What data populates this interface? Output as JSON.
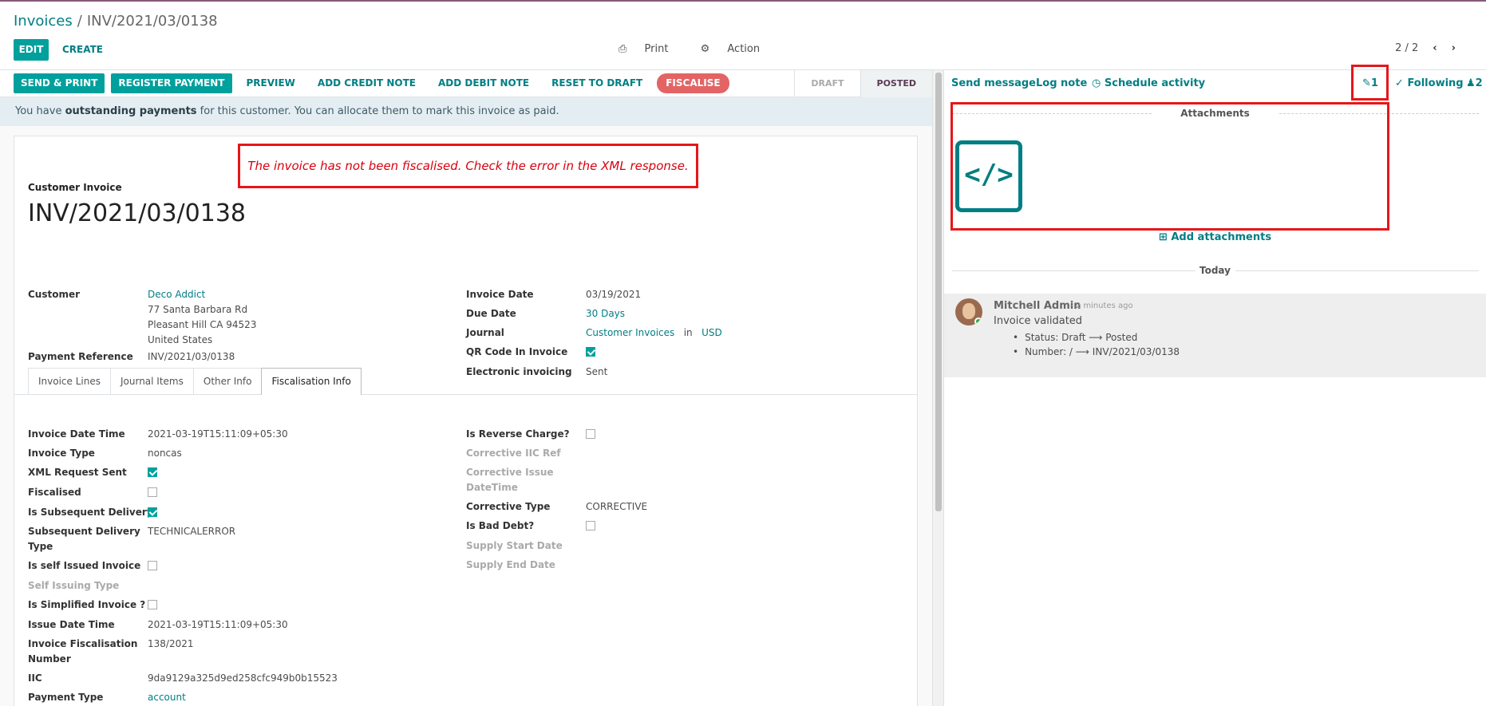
{
  "breadcrumb": {
    "parent": "Invoices",
    "separator": "/",
    "current": "INV/2021/03/0138"
  },
  "control_panel": {
    "edit_label": "EDIT",
    "create_label": "CREATE",
    "print_label": "Print",
    "action_label": "Action",
    "pager_value": "2 / 2",
    "prev_glyph": "‹",
    "next_glyph": "›"
  },
  "statusbar": {
    "buttons": [
      "SEND & PRINT",
      "REGISTER PAYMENT",
      "PREVIEW",
      "ADD CREDIT NOTE",
      "ADD DEBIT NOTE",
      "RESET TO DRAFT",
      "FISCALISE"
    ],
    "states": [
      "DRAFT",
      "POSTED"
    ],
    "active_state": "POSTED"
  },
  "alert": {
    "prefix": "You have",
    "bold": "outstanding payments",
    "suffix": "for this customer. You can allocate them to mark this invoice as paid."
  },
  "error_message": "The invoice has not been fiscalised. Check the error in the XML response.",
  "invoice": {
    "type_label": "Customer Invoice",
    "number": "INV/2021/03/0138",
    "customer_label": "Customer",
    "customer_name": "Deco Addict",
    "address_lines": [
      "77 Santa Barbara Rd",
      "Pleasant Hill CA 94523",
      "United States"
    ],
    "payment_ref_label": "Payment Reference",
    "payment_ref": "INV/2021/03/0138",
    "invoice_date_label": "Invoice Date",
    "invoice_date": "03/19/2021",
    "due_date_label": "Due Date",
    "due_date": "30 Days",
    "journal_label": "Journal",
    "journal": "Customer Invoices",
    "journal_in": "in",
    "currency": "USD",
    "qr_label": "QR Code In Invoice",
    "qr_checked": true,
    "einv_label": "Electronic invoicing",
    "einv_value": "Sent"
  },
  "tabs": [
    "Invoice Lines",
    "Journal Items",
    "Other Info",
    "Fiscalisation Info"
  ],
  "active_tab": "Fiscalisation Info",
  "fiscal": {
    "invoice_datetime_label": "Invoice Date Time",
    "invoice_datetime": "2021-03-19T15:11:09+05:30",
    "invoice_type_label": "Invoice Type",
    "invoice_type": "noncas",
    "xml_sent_label": "XML Request Sent",
    "fiscalised_label": "Fiscalised",
    "subsequent_label": "Is Subsequent Delivery",
    "subsequent_type_label_1": "Subsequent Delivery",
    "subsequent_type_label_2": "Type",
    "subsequent_type": "TECHNICALERROR",
    "self_issued_label": "Is self Issued Invoice",
    "self_issuing_type_label": "Self Issuing Type",
    "simplified_label": "Is Simplified Invoice ?",
    "issue_datetime_label": "Issue Date Time",
    "issue_datetime": "2021-03-19T15:11:09+05:30",
    "fisc_number_label_1": "Invoice Fiscalisation",
    "fisc_number_label_2": "Number",
    "fisc_number": "138/2021",
    "iic_label": "IIC",
    "iic": "9da9129a325d9ed258cfc949b0b15523",
    "payment_type_label": "Payment Type",
    "payment_type": "account",
    "reverse_charge_label": "Is Reverse Charge?",
    "corr_iic_label": "Corrective IIC Ref",
    "corr_issue_label_1": "Corrective Issue",
    "corr_issue_label_2": "DateTime",
    "corr_type_label": "Corrective Type",
    "corr_type": "CORRECTIVE",
    "bad_debt_label": "Is Bad Debt?",
    "supply_start_label": "Supply Start Date",
    "supply_end_label": "Supply End Date"
  },
  "chatter": {
    "send_message": "Send message",
    "log_note": "Log note",
    "schedule_activity": "Schedule activity",
    "attachment_count": "1",
    "following": "Following",
    "followers_count": "2",
    "attachments_title": "Attachments",
    "add_attachments": "Add attachments",
    "today": "Today",
    "message": {
      "author": "Mitchell Admin",
      "time": "- 2 minutes ago",
      "body": "Invoice validated",
      "changes": [
        "Status: Draft ⟶ Posted",
        "Number: / ⟶ INV/2021/03/0138"
      ]
    }
  },
  "colors": {
    "accent": "#017e84",
    "primary_button": "#00a09d",
    "danger": "#e36464",
    "highlight_red": "#e6161a",
    "topbar": "#875a7b"
  }
}
